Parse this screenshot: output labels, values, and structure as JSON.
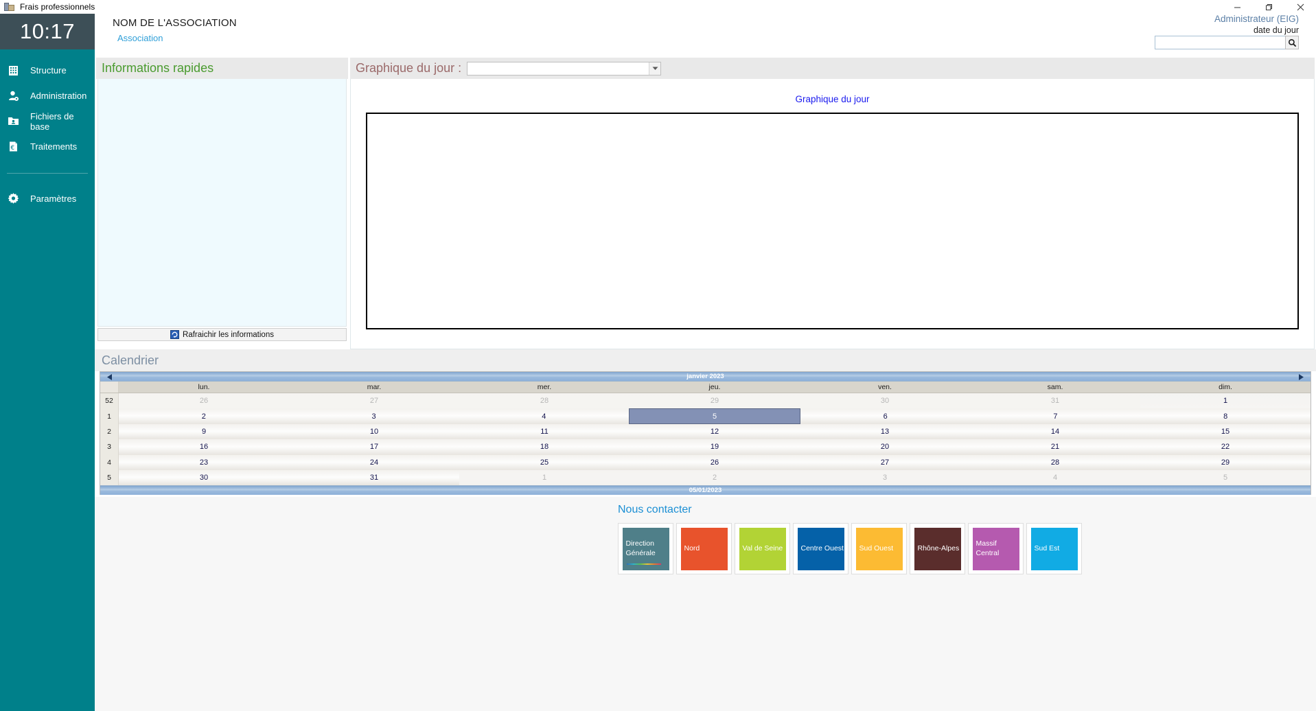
{
  "window": {
    "title": "Frais professionnels",
    "app_icon": "app-icon",
    "minimize": "minimize-icon",
    "maximize": "maximize-icon",
    "close": "close-icon"
  },
  "sidebar": {
    "clock": "10:17",
    "items": [
      {
        "label": "Structure",
        "icon": "building-icon"
      },
      {
        "label": "Administration",
        "icon": "user-gear-icon"
      },
      {
        "label": "Fichiers de base",
        "icon": "folder-user-icon"
      },
      {
        "label": "Traitements",
        "icon": "document-euro-icon"
      },
      {
        "label": "Paramètres",
        "icon": "gear-icon"
      }
    ],
    "background": "#00808a",
    "clock_background": "#3d4f57"
  },
  "header": {
    "association_name": "NOM DE L'ASSOCIATION",
    "association_sub": "Association",
    "user": "Administrateur (EIG)",
    "date_label": "date du jour",
    "search_value": "",
    "search_placeholder": "",
    "search_icon": "search-icon"
  },
  "quick_info": {
    "title": "Informations rapides",
    "title_color": "#4a9b2f",
    "body_text": "",
    "refresh_label": "Rafraichir les informations",
    "refresh_icon": "refresh-icon"
  },
  "chart_panel": {
    "title": "Graphique du jour :",
    "title_color": "#9b6a6a",
    "select_value": "",
    "select_arrow": "chevron-down-icon",
    "plot_title": "Graphique du jour",
    "plot_title_color": "#1a1aee"
  },
  "chart_data": {
    "type": "line",
    "title": "Graphique du jour",
    "xlabel": "",
    "ylabel": "",
    "categories": [],
    "values": [],
    "series": [],
    "grid": false,
    "legend": "none",
    "note": "Plot area is empty — no data rendered in the screenshot"
  },
  "calendar": {
    "title": "Calendrier",
    "title_color": "#7d8fa3",
    "month": "janvier 2023",
    "prev_icon": "triangle-left-icon",
    "next_icon": "triangle-right-icon",
    "day_headers": [
      "lun.",
      "mar.",
      "mer.",
      "jeu.",
      "ven.",
      "sam.",
      "dim."
    ],
    "selected_day": "5",
    "footer_date": "05/01/2023",
    "weeks": [
      {
        "number": "52",
        "days": [
          {
            "n": "26",
            "out": true
          },
          {
            "n": "27",
            "out": true
          },
          {
            "n": "28",
            "out": true
          },
          {
            "n": "29",
            "out": true
          },
          {
            "n": "30",
            "out": true
          },
          {
            "n": "31",
            "out": true
          },
          {
            "n": "1",
            "out": false
          }
        ]
      },
      {
        "number": "1",
        "days": [
          {
            "n": "2",
            "out": false
          },
          {
            "n": "3",
            "out": false
          },
          {
            "n": "4",
            "out": false
          },
          {
            "n": "5",
            "out": false,
            "selected": true
          },
          {
            "n": "6",
            "out": false
          },
          {
            "n": "7",
            "out": false
          },
          {
            "n": "8",
            "out": false
          }
        ]
      },
      {
        "number": "2",
        "days": [
          {
            "n": "9",
            "out": false
          },
          {
            "n": "10",
            "out": false
          },
          {
            "n": "11",
            "out": false
          },
          {
            "n": "12",
            "out": false
          },
          {
            "n": "13",
            "out": false
          },
          {
            "n": "14",
            "out": false
          },
          {
            "n": "15",
            "out": false
          }
        ]
      },
      {
        "number": "3",
        "days": [
          {
            "n": "16",
            "out": false
          },
          {
            "n": "17",
            "out": false
          },
          {
            "n": "18",
            "out": false
          },
          {
            "n": "19",
            "out": false
          },
          {
            "n": "20",
            "out": false
          },
          {
            "n": "21",
            "out": false
          },
          {
            "n": "22",
            "out": false
          }
        ]
      },
      {
        "number": "4",
        "days": [
          {
            "n": "23",
            "out": false
          },
          {
            "n": "24",
            "out": false
          },
          {
            "n": "25",
            "out": false
          },
          {
            "n": "26",
            "out": false
          },
          {
            "n": "27",
            "out": false
          },
          {
            "n": "28",
            "out": false
          },
          {
            "n": "29",
            "out": false
          }
        ]
      },
      {
        "number": "5",
        "days": [
          {
            "n": "30",
            "out": false
          },
          {
            "n": "31",
            "out": false
          },
          {
            "n": "1",
            "out": true
          },
          {
            "n": "2",
            "out": true
          },
          {
            "n": "3",
            "out": true
          },
          {
            "n": "4",
            "out": true
          },
          {
            "n": "5",
            "out": true
          }
        ]
      }
    ]
  },
  "contact": {
    "title": "Nous contacter",
    "title_color": "#1b8fd4",
    "tiles": [
      {
        "label": "Direction Générale",
        "color": "#4f7f89",
        "stripe": true
      },
      {
        "label": "Nord",
        "color": "#e8532c",
        "stripe": false
      },
      {
        "label": "Val de Seine",
        "color": "#b2d335",
        "stripe": false
      },
      {
        "label": "Centre Ouest",
        "color": "#0561a8",
        "stripe": false
      },
      {
        "label": "Sud Ouest",
        "color": "#fcbb33",
        "stripe": false
      },
      {
        "label": "Rhône-Alpes",
        "color": "#5a2d2c",
        "stripe": false
      },
      {
        "label": "Massif Central",
        "color": "#b55aaf",
        "stripe": false
      },
      {
        "label": "Sud Est",
        "color": "#11abe4",
        "stripe": false
      }
    ]
  }
}
